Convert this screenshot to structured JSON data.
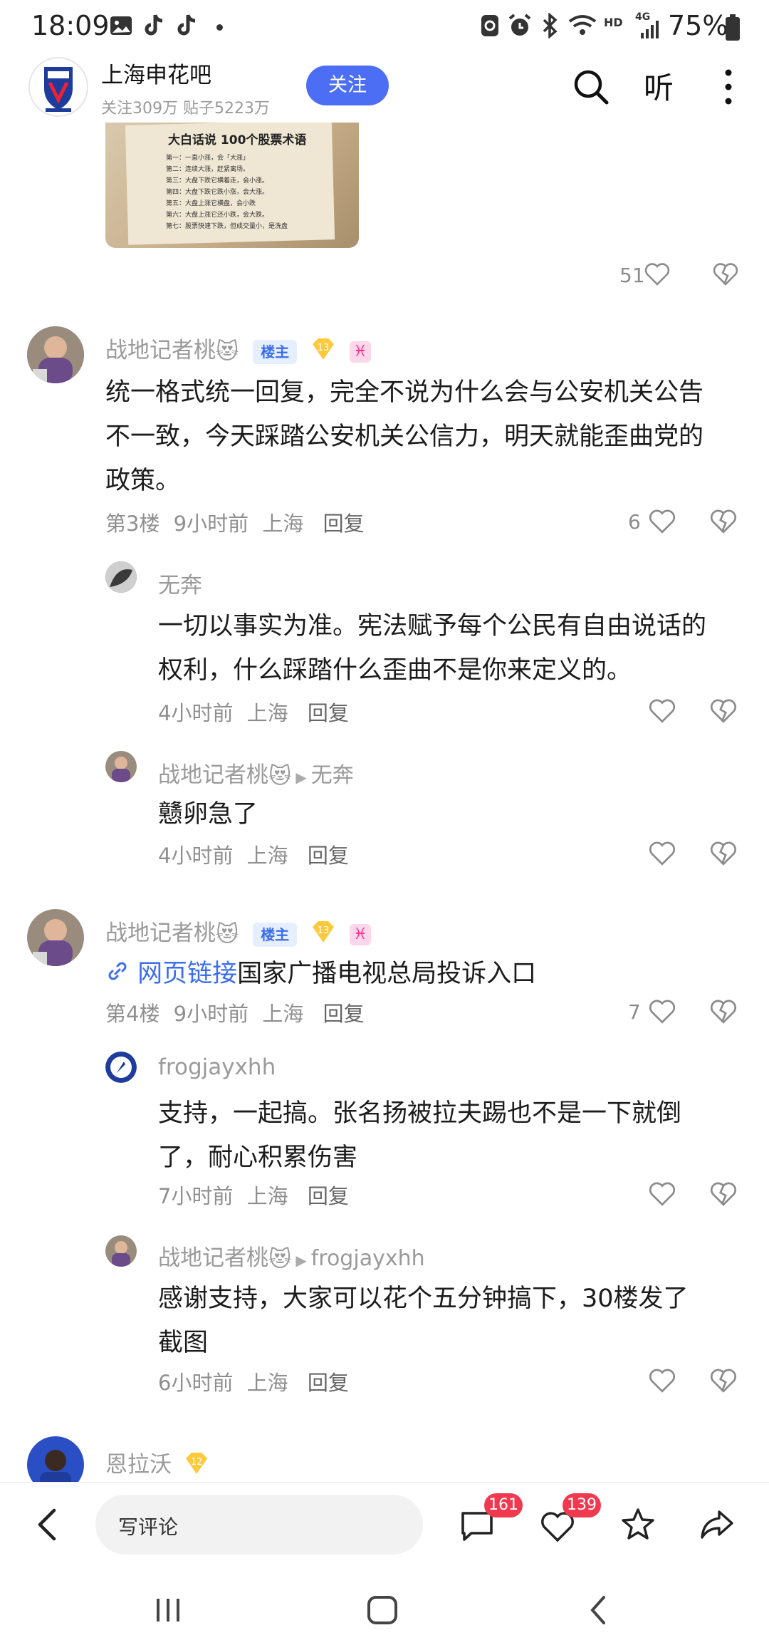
{
  "status_bar": {
    "time": "18:09",
    "network": "4G",
    "hd": "HD",
    "battery": "75%"
  },
  "header": {
    "forum_name": "上海申花吧",
    "stats": "关注309万 贴子5223万",
    "follow_label": "关注",
    "listen_label": "听"
  },
  "post_image": {
    "title": "大白话说 100个股票术语",
    "lines": [
      "第一：一直小涨，会「大涨」",
      "第二：连续大涨，赶紧离场。",
      "第三：大盘下跌它横着走，会小涨。",
      "第四：大盘下跌它跌小涨，会大涨。",
      "第五：大盘上涨它横盘，会小跌",
      "第六：大盘上涨它还小跌，会大跌。",
      "第七：股票快速下跌，但成交量小，是洗盘"
    ]
  },
  "post": {
    "like_count": "51"
  },
  "comments": [
    {
      "user": "战地记者桃",
      "emoji": "😻",
      "tag": "楼主",
      "level": "13",
      "zodiac": "♓",
      "text_line1": "统一格式统一回复，完全不说为什么会与公安机关公告",
      "text_line2": "不一致，今天踩踏公安机关公信力，明天就能歪曲党的",
      "text_line3": "政策。",
      "floor": "第3楼",
      "time": "9小时前",
      "location": "上海",
      "reply_label": "回复",
      "likes": "6"
    },
    {
      "user": "战地记者桃",
      "emoji": "😻",
      "tag": "楼主",
      "level": "13",
      "zodiac": "♓",
      "link_label": "网页链接",
      "text": "国家广播电视总局投诉入口",
      "floor": "第4楼",
      "time": "9小时前",
      "location": "上海",
      "reply_label": "回复",
      "likes": "7"
    },
    {
      "user": "恩拉沃",
      "level": "12"
    }
  ],
  "sub_replies": [
    {
      "user": "无奔",
      "text_line1": "一切以事实为准。宪法赋予每个公民有自由说话的",
      "text_line2": "权利，什么踩踏什么歪曲不是你来定义的。",
      "time": "4小时前",
      "location": "上海",
      "reply_label": "回复"
    },
    {
      "user": "战地记者桃",
      "emoji": "😻",
      "target": "无奔",
      "text": "戆卵急了",
      "time": "4小时前",
      "location": "上海",
      "reply_label": "回复"
    },
    {
      "user": "frogjayxhh",
      "text_line1": "支持，一起搞。张名扬被拉夫踢也不是一下就倒",
      "text_line2": "了，耐心积累伤害",
      "time": "7小时前",
      "location": "上海",
      "reply_label": "回复"
    },
    {
      "user": "战地记者桃",
      "emoji": "😻",
      "target": "frogjayxhh",
      "text_line1": "感谢支持，大家可以花个五分钟搞下，30楼发了",
      "text_line2": "截图",
      "time": "6小时前",
      "location": "上海",
      "reply_label": "回复"
    }
  ],
  "bottom_bar": {
    "comment_placeholder": "写评论",
    "comment_count": "161",
    "like_count": "139"
  },
  "colors": {
    "accent": "#4b6ef5",
    "badge": "#f0384f",
    "link": "#3b6df0"
  },
  "icons": [
    "image-icon",
    "tiktok-icon",
    "recycle-icon",
    "alarm-icon",
    "bluetooth-icon",
    "wifi-icon",
    "signal-icon",
    "battery-icon",
    "search-icon",
    "more-icon",
    "heart-icon",
    "broken-heart-icon",
    "link-icon",
    "back-icon",
    "comment-icon",
    "star-icon",
    "share-icon"
  ]
}
